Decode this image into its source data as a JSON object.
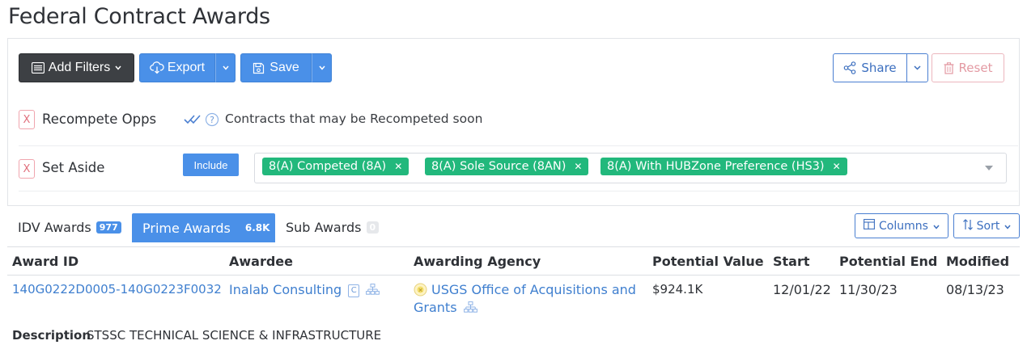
{
  "page": {
    "title": "Federal Contract Awards"
  },
  "toolbar": {
    "add_filters": "Add Filters",
    "export": "Export",
    "save": "Save",
    "share": "Share",
    "reset": "Reset"
  },
  "filters": {
    "recompete": {
      "remove": "X",
      "label": "Recompete Opps",
      "description": "Contracts that may be Recompeted soon"
    },
    "set_aside": {
      "remove": "X",
      "label": "Set Aside",
      "mode": "Include",
      "tags": [
        {
          "label": "8(A) Competed (8A)"
        },
        {
          "label": "8(A) Sole Source (8AN)"
        },
        {
          "label": "8(A) With HUBZone Preference (HS3)"
        }
      ]
    }
  },
  "tabs": [
    {
      "label": "IDV Awards",
      "count": "977"
    },
    {
      "label": "Prime Awards",
      "count": "6.8K",
      "active": true
    },
    {
      "label": "Sub Awards",
      "count": "0"
    }
  ],
  "table_controls": {
    "columns": "Columns",
    "sort": "Sort"
  },
  "table": {
    "columns": [
      "Award ID",
      "Awardee",
      "Awarding Agency",
      "Potential Value",
      "Start",
      "Potential End",
      "Modified"
    ],
    "rows": [
      {
        "award_id": "140G0222D0005-140G0223F0032",
        "awardee": "Inalab Consulting",
        "awardee_badge": "C",
        "agency_line1": "USGS Office of Acquisitions and",
        "agency_line2": "Grants",
        "potential_value": "$924.1K",
        "start": "12/01/22",
        "potential_end": "11/30/23",
        "modified": "08/13/23",
        "description_label": "Description",
        "description": "STSSC TECHNICAL SCIENCE & INFRASTRUCTURE"
      }
    ]
  },
  "colors": {
    "primary": "#4a90e8",
    "dark_button": "#3d4044",
    "tag_green": "#22b87c",
    "link": "#3f7fcf",
    "danger_outline": "#ecb6bd"
  }
}
